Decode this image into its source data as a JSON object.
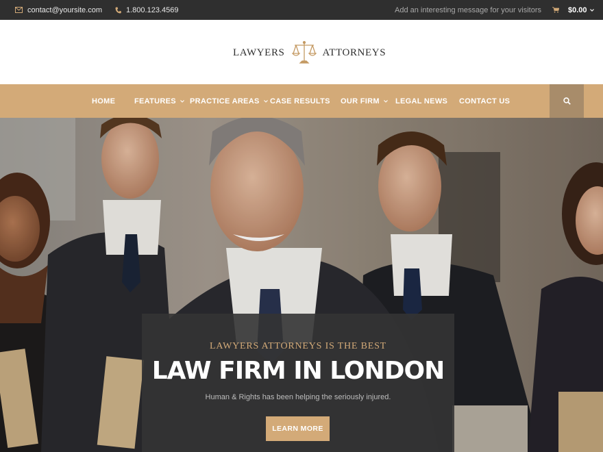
{
  "topbar": {
    "email": "contact@yoursite.com",
    "phone": "1.800.123.4569",
    "message": "Add an interesting message for your visitors",
    "cart_total": "$0.00"
  },
  "logo": {
    "left_word": "LAWYERS",
    "right_word": "ATTORNEYS",
    "icon": "scales-of-justice-icon"
  },
  "nav": {
    "items": [
      {
        "label": "HOME",
        "has_dropdown": false
      },
      {
        "label": "FEATURES",
        "has_dropdown": true
      },
      {
        "label": "PRACTICE AREAS",
        "has_dropdown": true
      },
      {
        "label": "CASE RESULTS",
        "has_dropdown": false
      },
      {
        "label": "OUR FIRM",
        "has_dropdown": true
      },
      {
        "label": "LEGAL NEWS",
        "has_dropdown": false
      },
      {
        "label": "CONTACT US",
        "has_dropdown": false
      }
    ],
    "search_icon": "search-icon"
  },
  "hero": {
    "kicker": "LAWYERS ATTORNEYS IS THE BEST",
    "headline": "LAW FIRM IN LONDON",
    "subtext": "Human & Rights has been helping the seriously injured.",
    "cta_label": "LEARN MORE"
  },
  "colors": {
    "accent": "#d3aa78",
    "topbar": "#2f2f2f",
    "caption_bg": "#343434"
  }
}
